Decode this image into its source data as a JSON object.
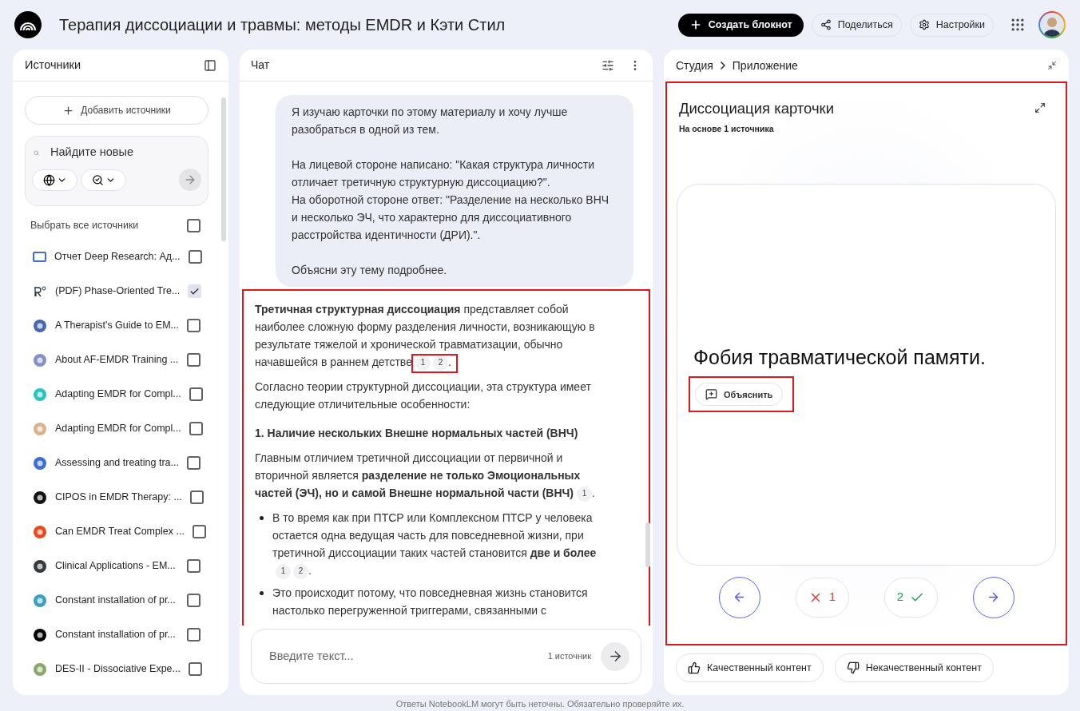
{
  "header": {
    "title": "Терапия диссоциации и травмы: методы EMDR и Кэти Стил",
    "create_button": "Создать блокнот",
    "share_button": "Поделиться",
    "settings_button": "Настройки"
  },
  "sources": {
    "title": "Источники",
    "add_button": "Добавить источники",
    "search": {
      "placeholder": "Найдите новые"
    },
    "select_all": {
      "label": "Выбрать все источники",
      "checked": false
    },
    "items": [
      {
        "kind": "report",
        "title": "Отчет Deep Research: Ад...",
        "checked": false
      },
      {
        "kind": "pdf",
        "title": "(PDF) Phase-Oriented Tre...",
        "checked": true
      },
      {
        "kind": "web",
        "title": "A Therapist's Guide to EM...",
        "checked": false
      },
      {
        "kind": "web",
        "title": "About AF-EMDR Training ...",
        "checked": false
      },
      {
        "kind": "web",
        "title": "Adapting EMDR for Compl...",
        "checked": false
      },
      {
        "kind": "web",
        "title": "Adapting EMDR for Compl...",
        "checked": false
      },
      {
        "kind": "web",
        "title": "Assessing and treating tra...",
        "checked": false
      },
      {
        "kind": "web",
        "title": "CIPOS in EMDR Therapy: ...",
        "checked": false
      },
      {
        "kind": "web",
        "title": "Can EMDR Treat Complex ...",
        "checked": false
      },
      {
        "kind": "web",
        "title": "Clinical Applications - EM...",
        "checked": false
      },
      {
        "kind": "web",
        "title": "Constant installation of pr...",
        "checked": false
      },
      {
        "kind": "web",
        "title": "Constant installation of pr...",
        "checked": false
      },
      {
        "kind": "web",
        "title": "DES-II - Dissociative Expe...",
        "checked": false
      }
    ]
  },
  "chat": {
    "title": "Чат",
    "user_message": [
      "Я изучаю карточки по этому материалу и хочу лучше разобраться в одной из тем.",
      "На лицевой стороне написано: \"Какая структура личности отличает третичную структурную диссоциацию?\".\nНа оборотной стороне ответ: \"Разделение на несколько ВНЧ и несколько ЭЧ, что характерно для диссоциативного расстройства идентичности (ДРИ).\".",
      "Объясни эту тему подробнее."
    ],
    "answer": {
      "highlighted": true,
      "blocks": [
        {
          "kind": "paragraph",
          "text": "**Третичная структурная диссоциация** представляет собой наиболее сложную форму разделения личности, возникающую в результате тяжелой и хронической травматизации, обычно начавшейся в раннем детстве",
          "citations": [
            "1",
            "2"
          ],
          "citations_highlighted": true,
          "end": "."
        },
        {
          "kind": "paragraph",
          "text": "Согласно теории структурной диссоциации, эта структура имеет следующие отличительные особенности:"
        },
        {
          "kind": "heading",
          "text": "1. Наличие нескольких Внешне нормальных частей (ВНЧ)"
        },
        {
          "kind": "paragraph",
          "text": "Главным отличием третичной диссоциации от первичной и вторичной является **разделение не только Эмоциональных частей (ЭЧ), но и самой Внешне нормальной части (ВНЧ)**",
          "citations": [
            "1"
          ],
          "end": "."
        },
        {
          "kind": "bullet",
          "text": "В то время как при ПТСР или Комплексном ПТСР у человека остается одна ведущая часть для повседневной жизни, при третичной диссоциации таких частей становится **две и более**",
          "citations": [
            "1",
            "2"
          ],
          "end": "."
        },
        {
          "kind": "bullet",
          "text": "Это происходит потому, что повседневная жизнь становится настолько перегруженной триггерами, связанными с"
        }
      ]
    },
    "input": {
      "placeholder": "Введите текст...",
      "source_count": "1 источник"
    }
  },
  "studio": {
    "breadcrumb": [
      "Студия",
      "Приложение"
    ],
    "highlighted": true,
    "title": "Диссоциация карточки",
    "subtitle": "На основе 1 источника",
    "card": {
      "front": "Фобия травматической памяти.",
      "explain_button": "Объяснить",
      "explain_highlighted": true
    },
    "wrong_count": "1",
    "right_count": "2",
    "feedback": {
      "good": "Качественный контент",
      "bad": "Некачественный контент"
    }
  },
  "footer": "Ответы NotebookLM могут быть неточны. Обязательно проверяйте их."
}
